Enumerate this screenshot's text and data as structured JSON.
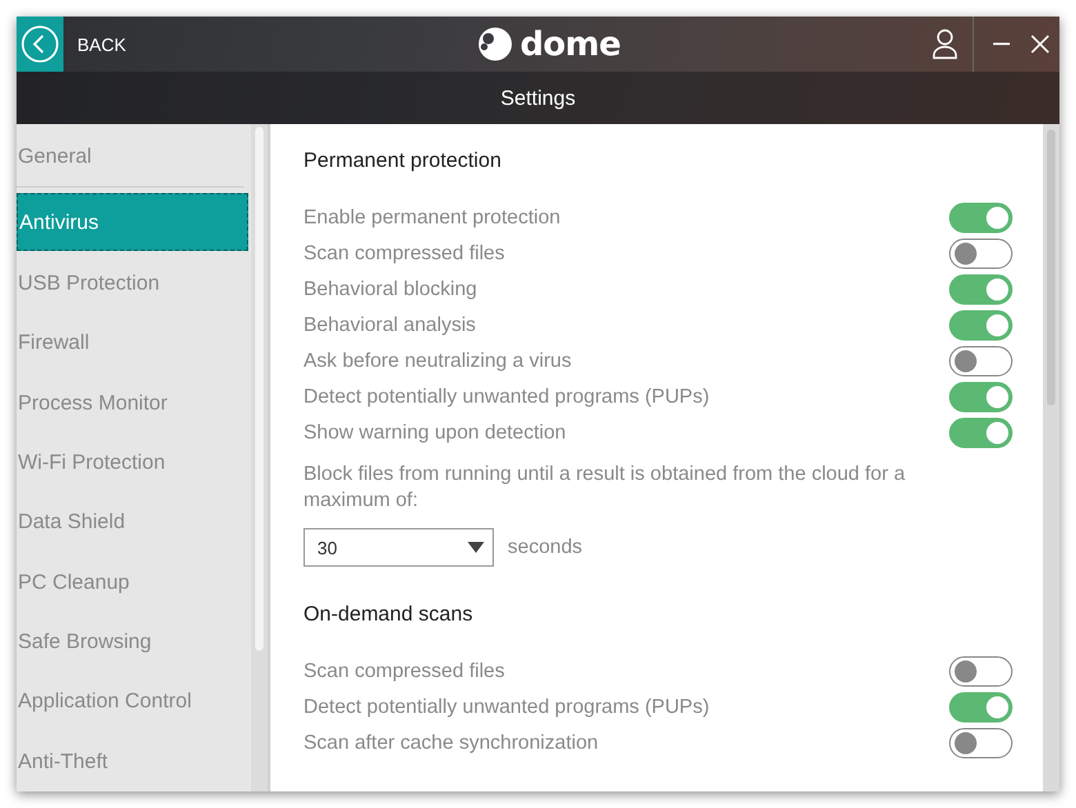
{
  "header": {
    "back_label": "BACK",
    "logo_text": "dome"
  },
  "title": "Settings",
  "sidebar": {
    "items": [
      {
        "label": "General",
        "selected": false
      },
      {
        "label": "Antivirus",
        "selected": true
      },
      {
        "label": "USB Protection",
        "selected": false
      },
      {
        "label": "Firewall",
        "selected": false
      },
      {
        "label": "Process Monitor",
        "selected": false
      },
      {
        "label": "Wi-Fi Protection",
        "selected": false
      },
      {
        "label": "Data Shield",
        "selected": false
      },
      {
        "label": "PC Cleanup",
        "selected": false
      },
      {
        "label": "Safe Browsing",
        "selected": false
      },
      {
        "label": "Application Control",
        "selected": false
      },
      {
        "label": "Anti-Theft",
        "selected": false
      }
    ]
  },
  "sections": [
    {
      "title": "Permanent protection",
      "settings": [
        {
          "label": "Enable permanent protection",
          "on": true
        },
        {
          "label": "Scan compressed files",
          "on": false
        },
        {
          "label": "Behavioral blocking",
          "on": true
        },
        {
          "label": "Behavioral analysis",
          "on": true
        },
        {
          "label": "Ask before neutralizing a virus",
          "on": false
        },
        {
          "label": "Detect potentially unwanted programs (PUPs)",
          "on": true
        },
        {
          "label": "Show warning upon detection",
          "on": true
        }
      ],
      "block_files": {
        "label": "Block files from running until a result is obtained from the cloud for a maximum of:",
        "value": "30",
        "unit": "seconds"
      }
    },
    {
      "title": "On-demand scans",
      "settings": [
        {
          "label": "Scan compressed files",
          "on": false
        },
        {
          "label": "Detect potentially unwanted programs (PUPs)",
          "on": true
        },
        {
          "label": "Scan after cache synchronization",
          "on": false
        }
      ]
    }
  ]
}
